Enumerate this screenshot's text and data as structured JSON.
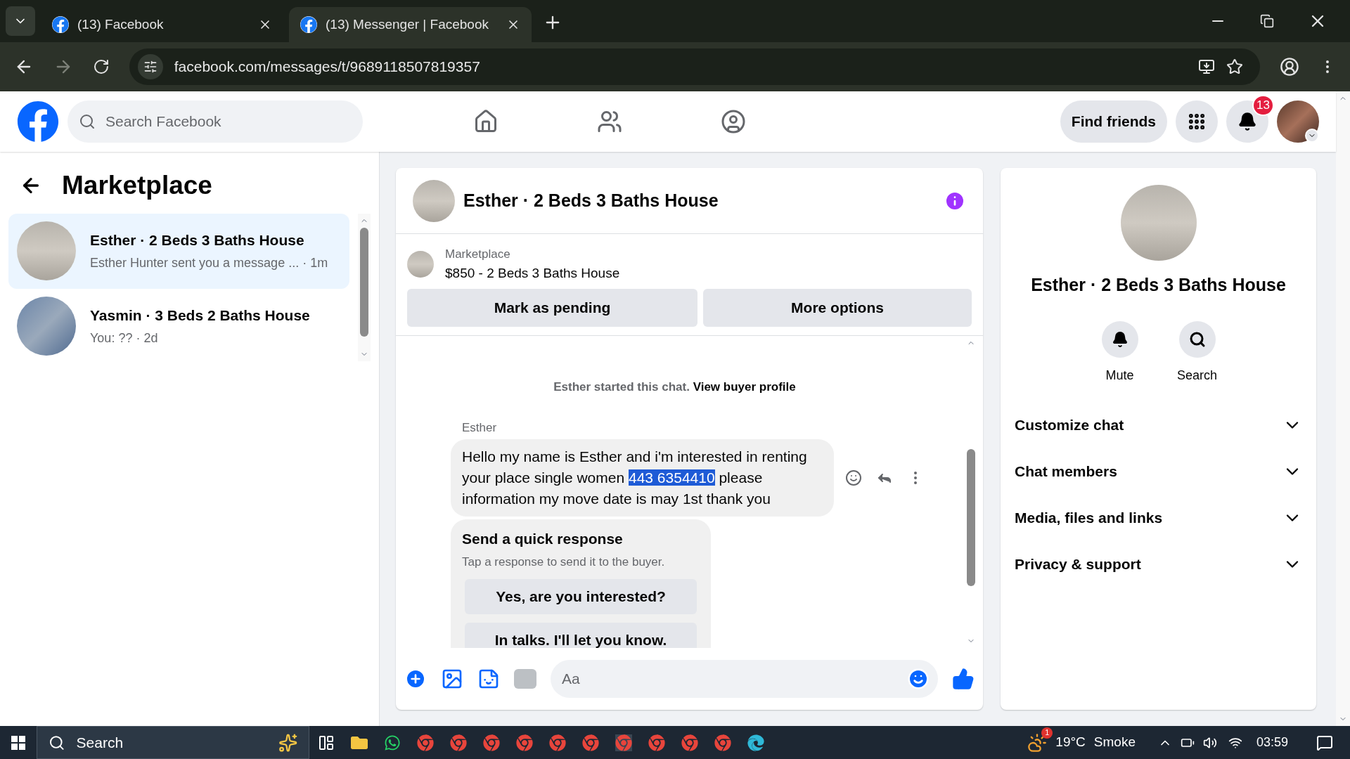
{
  "browser": {
    "tabs": [
      {
        "title": "(13) Facebook",
        "selected": false
      },
      {
        "title": "(13) Messenger | Facebook",
        "selected": true
      }
    ],
    "url": "facebook.com/messages/t/9689118507819357"
  },
  "header": {
    "search_placeholder": "Search Facebook",
    "find_friends": "Find friends",
    "notification_count": "13"
  },
  "sidebar": {
    "title": "Marketplace",
    "conversations": [
      {
        "title": "Esther · 2 Beds 3 Baths House",
        "subtitle": "Esther Hunter sent you a message ... · 1m",
        "selected": true
      },
      {
        "title": "Yasmin · 3 Beds 2 Baths House",
        "subtitle": "You: ?? · 2d",
        "selected": false
      }
    ]
  },
  "chat": {
    "title": "Esther · 2 Beds 3 Baths House",
    "listing": {
      "label": "Marketplace",
      "price_title": "$850 - 2 Beds 3 Baths House"
    },
    "buttons": [
      "Mark as pending",
      "More options"
    ],
    "system_note": "Esther started this chat.",
    "system_link": "View buyer profile",
    "sender": "Esther",
    "message_parts": [
      {
        "text": "Hello my name is Esther and i'm interested in renting your place single women ",
        "highlighted": false
      },
      {
        "text": "443 6354410",
        "highlighted": true
      },
      {
        "text": " please information my move date is may 1st thank you",
        "highlighted": false
      }
    ],
    "quick_response": {
      "title": "Send a quick response",
      "hint": "Tap a response to send it to the buyer.",
      "options": [
        "Yes, are you interested?",
        "In talks. I'll let you know."
      ]
    },
    "composer_placeholder": "Aa"
  },
  "details": {
    "name": "Esther · 2 Beds 3 Baths House",
    "actions": [
      {
        "kind": "mute",
        "label": "Mute"
      },
      {
        "kind": "search",
        "label": "Search"
      }
    ],
    "sections": [
      {
        "label": "Customize chat",
        "expanded": false
      },
      {
        "label": "Chat members",
        "expanded": false
      },
      {
        "label": "Media, files and links",
        "expanded": false
      },
      {
        "label": "Privacy & support",
        "expanded": false
      }
    ]
  },
  "taskbar": {
    "search_placeholder": "Search",
    "weather_badge": "1",
    "temperature": "19°C",
    "condition": "Smoke",
    "time": "03:59"
  }
}
